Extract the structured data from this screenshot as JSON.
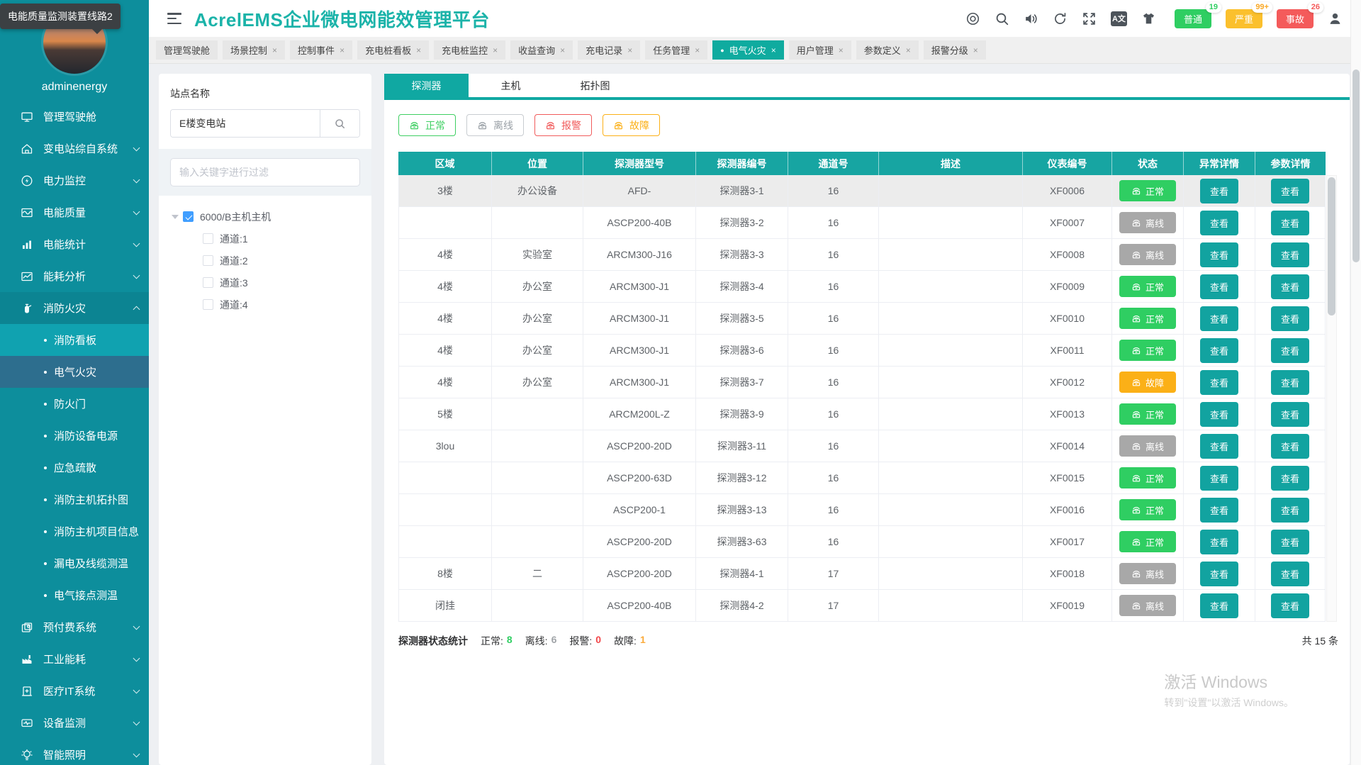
{
  "tooltip": {
    "text": "电能质量监测装置线路2"
  },
  "glyphs": {
    "close": "×",
    "dot": "●",
    "translate": "A文"
  },
  "sidebar": {
    "username": "adminenergy",
    "menu": [
      {
        "key": "dashboard",
        "label": "管理驾驶舱",
        "icon": "monitor",
        "arrow": false
      },
      {
        "key": "substation",
        "label": "变电站综自系统",
        "icon": "home",
        "arrow": true
      },
      {
        "key": "power-monitor",
        "label": "电力监控",
        "icon": "power",
        "arrow": true
      },
      {
        "key": "power-quality",
        "label": "电能质量",
        "icon": "quality",
        "arrow": true
      },
      {
        "key": "energy-stats",
        "label": "电能统计",
        "icon": "stats",
        "arrow": true
      },
      {
        "key": "energy-analysis",
        "label": "能耗分析",
        "icon": "analysis",
        "arrow": true
      },
      {
        "key": "fire-safety",
        "label": "消防火灾",
        "icon": "fire",
        "arrow": true,
        "expanded": true,
        "children": [
          {
            "key": "fire-board",
            "label": "消防看板",
            "state": "hover"
          },
          {
            "key": "electric-fire",
            "label": "电气火灾",
            "state": "active"
          },
          {
            "key": "fire-door",
            "label": "防火门",
            "state": ""
          },
          {
            "key": "fire-equip-power",
            "label": "消防设备电源",
            "state": ""
          },
          {
            "key": "emergency-evacuation",
            "label": "应急疏散",
            "state": ""
          },
          {
            "key": "fire-host-topology",
            "label": "消防主机拓扑图",
            "state": ""
          },
          {
            "key": "fire-host-project-info",
            "label": "消防主机项目信息",
            "state": ""
          },
          {
            "key": "leakage-cable-temp",
            "label": "漏电及线缆测温",
            "state": ""
          },
          {
            "key": "electric-contact-temp",
            "label": "电气接点测温",
            "state": ""
          }
        ]
      },
      {
        "key": "prepaid-system",
        "label": "预付费系统",
        "icon": "prepaid",
        "arrow": true
      },
      {
        "key": "industrial-energy",
        "label": "工业能耗",
        "icon": "industry",
        "arrow": true
      },
      {
        "key": "medical-it",
        "label": "医疗IT系统",
        "icon": "medical",
        "arrow": true
      },
      {
        "key": "device-monitor",
        "label": "设备监测",
        "icon": "device",
        "arrow": true
      },
      {
        "key": "smart-lighting",
        "label": "智能照明",
        "icon": "bulb",
        "arrow": true
      }
    ]
  },
  "header": {
    "title": "AcrelEMS企业微电网能效管理平台",
    "alerts": [
      {
        "key": "normal-alerts",
        "label": "普通",
        "count": "19",
        "color": "green"
      },
      {
        "key": "severe-alerts",
        "label": "严重",
        "count": "99+",
        "color": "orange"
      },
      {
        "key": "accident-alerts",
        "label": "事故",
        "count": "26",
        "color": "red"
      }
    ]
  },
  "tabbar": {
    "tabs": [
      {
        "label": "管理驾驶舱",
        "closable": false,
        "active": false
      },
      {
        "label": "场景控制",
        "closable": true,
        "active": false
      },
      {
        "label": "控制事件",
        "closable": true,
        "active": false
      },
      {
        "label": "充电桩看板",
        "closable": true,
        "active": false
      },
      {
        "label": "充电桩监控",
        "closable": true,
        "active": false
      },
      {
        "label": "收益查询",
        "closable": true,
        "active": false
      },
      {
        "label": "充电记录",
        "closable": true,
        "active": false
      },
      {
        "label": "任务管理",
        "closable": true,
        "active": false
      },
      {
        "label": "电气火灾",
        "closable": true,
        "active": true
      },
      {
        "label": "用户管理",
        "closable": true,
        "active": false
      },
      {
        "label": "参数定义",
        "closable": true,
        "active": false
      },
      {
        "label": "报警分级",
        "closable": true,
        "active": false
      }
    ]
  },
  "site_panel": {
    "label": "站点名称",
    "search_value": "E楼变电站",
    "filter_placeholder": "输入关键字进行过滤",
    "tree": {
      "root": {
        "label": "6000/B主机主机",
        "checked": true
      },
      "children": [
        {
          "label": "通道:1",
          "checked": false
        },
        {
          "label": "通道:2",
          "checked": false
        },
        {
          "label": "通道:3",
          "checked": false
        },
        {
          "label": "通道:4",
          "checked": false
        }
      ]
    }
  },
  "main": {
    "tabs": [
      {
        "label": "探测器",
        "active": true
      },
      {
        "label": "主机",
        "active": false
      },
      {
        "label": "拓扑图",
        "active": false
      }
    ],
    "filters": [
      {
        "type": "normal",
        "label": "正常"
      },
      {
        "type": "offline",
        "label": "离线"
      },
      {
        "type": "alarm",
        "label": "报警"
      },
      {
        "type": "fault",
        "label": "故障"
      }
    ],
    "status_labels": {
      "normal": "正常",
      "offline": "离线",
      "alarm": "报警",
      "fault": "故障"
    },
    "table": {
      "columns": [
        "区域",
        "位置",
        "探测器型号",
        "探测器编号",
        "通道号",
        "描述",
        "仪表编号",
        "状态",
        "异常详情",
        "参数详情"
      ],
      "view_label": "查看",
      "rows": [
        {
          "area": "3楼",
          "location": "办公设备",
          "model": "AFD-",
          "code": "探测器3-1",
          "channel": "16",
          "desc": "",
          "meter": "XF0006",
          "status": "normal",
          "hover": true
        },
        {
          "area": "",
          "location": "",
          "model": "ASCP200-40B",
          "code": "探测器3-2",
          "channel": "16",
          "desc": "",
          "meter": "XF0007",
          "status": "offline",
          "hover": false
        },
        {
          "area": "4楼",
          "location": "实验室",
          "model": "ARCM300-J16",
          "code": "探测器3-3",
          "channel": "16",
          "desc": "",
          "meter": "XF0008",
          "status": "offline",
          "hover": false
        },
        {
          "area": "4楼",
          "location": "办公室",
          "model": "ARCM300-J1",
          "code": "探测器3-4",
          "channel": "16",
          "desc": "",
          "meter": "XF0009",
          "status": "normal",
          "hover": false
        },
        {
          "area": "4楼",
          "location": "办公室",
          "model": "ARCM300-J1",
          "code": "探测器3-5",
          "channel": "16",
          "desc": "",
          "meter": "XF0010",
          "status": "normal",
          "hover": false
        },
        {
          "area": "4楼",
          "location": "办公室",
          "model": "ARCM300-J1",
          "code": "探测器3-6",
          "channel": "16",
          "desc": "",
          "meter": "XF0011",
          "status": "normal",
          "hover": false
        },
        {
          "area": "4楼",
          "location": "办公室",
          "model": "ARCM300-J1",
          "code": "探测器3-7",
          "channel": "16",
          "desc": "",
          "meter": "XF0012",
          "status": "fault",
          "hover": false
        },
        {
          "area": "5楼",
          "location": "",
          "model": "ARCM200L-Z",
          "code": "探测器3-9",
          "channel": "16",
          "desc": "",
          "meter": "XF0013",
          "status": "normal",
          "hover": false
        },
        {
          "area": "3lou",
          "location": "",
          "model": "ASCP200-20D",
          "code": "探测器3-11",
          "channel": "16",
          "desc": "",
          "meter": "XF0014",
          "status": "offline",
          "hover": false
        },
        {
          "area": "",
          "location": "",
          "model": "ASCP200-63D",
          "code": "探测器3-12",
          "channel": "16",
          "desc": "",
          "meter": "XF0015",
          "status": "normal",
          "hover": false
        },
        {
          "area": "",
          "location": "",
          "model": "ASCP200-1",
          "code": "探测器3-13",
          "channel": "16",
          "desc": "",
          "meter": "XF0016",
          "status": "normal",
          "hover": false
        },
        {
          "area": "",
          "location": "",
          "model": "ASCP200-20D",
          "code": "探测器3-63",
          "channel": "16",
          "desc": "",
          "meter": "XF0017",
          "status": "normal",
          "hover": false
        },
        {
          "area": "8楼",
          "location": "二",
          "model": "ASCP200-20D",
          "code": "探测器4-1",
          "channel": "17",
          "desc": "",
          "meter": "XF0018",
          "status": "offline",
          "hover": false
        },
        {
          "area": "闭挂",
          "location": "",
          "model": "ASCP200-40B",
          "code": "探测器4-2",
          "channel": "17",
          "desc": "",
          "meter": "XF0019",
          "status": "offline",
          "hover": false
        }
      ]
    },
    "footer": {
      "stats_label": "探测器状态统计",
      "stats": [
        {
          "type": "normal",
          "label": "正常:",
          "value": "8"
        },
        {
          "type": "offline",
          "label": "离线:",
          "value": "6"
        },
        {
          "type": "alarm",
          "label": "报警:",
          "value": "0"
        },
        {
          "type": "fault",
          "label": "故障:",
          "value": "1"
        }
      ],
      "total": "共 15 条"
    }
  },
  "watermark": {
    "line1": "激活 Windows",
    "line2": "转到\"设置\"以激活 Windows。"
  }
}
